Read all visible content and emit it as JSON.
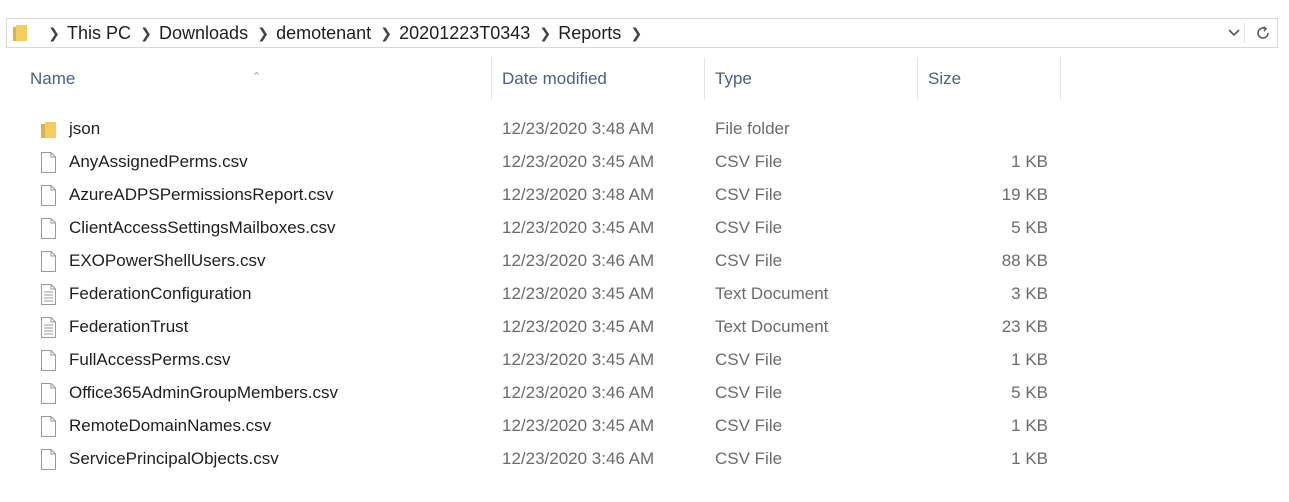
{
  "address": {
    "breadcrumbs": [
      "This PC",
      "Downloads",
      "demotenant",
      "20201223T0343",
      "Reports"
    ],
    "dropdown_icon": "chevron-down-icon",
    "refresh_icon": "refresh-icon"
  },
  "columns": {
    "name": "Name",
    "date": "Date modified",
    "type": "Type",
    "size": "Size"
  },
  "files": [
    {
      "name": "json",
      "date": "12/23/2020 3:48 AM",
      "type": "File folder",
      "size": "",
      "icon": "folder-icon"
    },
    {
      "name": "AnyAssignedPerms.csv",
      "date": "12/23/2020 3:45 AM",
      "type": "CSV File",
      "size": "1 KB",
      "icon": "csv-file-icon"
    },
    {
      "name": "AzureADPSPermissionsReport.csv",
      "date": "12/23/2020 3:48 AM",
      "type": "CSV File",
      "size": "19 KB",
      "icon": "csv-file-icon"
    },
    {
      "name": "ClientAccessSettingsMailboxes.csv",
      "date": "12/23/2020 3:45 AM",
      "type": "CSV File",
      "size": "5 KB",
      "icon": "csv-file-icon"
    },
    {
      "name": "EXOPowerShellUsers.csv",
      "date": "12/23/2020 3:46 AM",
      "type": "CSV File",
      "size": "88 KB",
      "icon": "csv-file-icon"
    },
    {
      "name": "FederationConfiguration",
      "date": "12/23/2020 3:45 AM",
      "type": "Text Document",
      "size": "3 KB",
      "icon": "text-document-icon"
    },
    {
      "name": "FederationTrust",
      "date": "12/23/2020 3:45 AM",
      "type": "Text Document",
      "size": "23 KB",
      "icon": "text-document-icon"
    },
    {
      "name": "FullAccessPerms.csv",
      "date": "12/23/2020 3:45 AM",
      "type": "CSV File",
      "size": "1 KB",
      "icon": "csv-file-icon"
    },
    {
      "name": "Office365AdminGroupMembers.csv",
      "date": "12/23/2020 3:46 AM",
      "type": "CSV File",
      "size": "5 KB",
      "icon": "csv-file-icon"
    },
    {
      "name": "RemoteDomainNames.csv",
      "date": "12/23/2020 3:45 AM",
      "type": "CSV File",
      "size": "1 KB",
      "icon": "csv-file-icon"
    },
    {
      "name": "ServicePrincipalObjects.csv",
      "date": "12/23/2020 3:46 AM",
      "type": "CSV File",
      "size": "1 KB",
      "icon": "csv-file-icon"
    }
  ]
}
